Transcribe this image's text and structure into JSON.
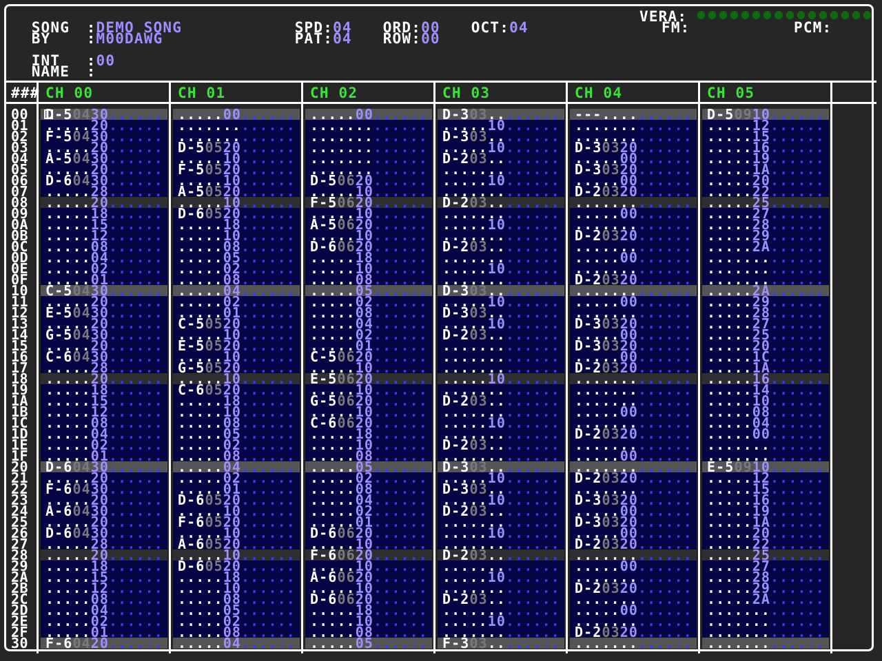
{
  "header": {
    "song_label": "SONG",
    "song_value": "DEMO SONG",
    "by_label": "BY",
    "by_value": "M00DAWG",
    "spd_label": "SPD:",
    "spd_value": "04",
    "pat_label": "PAT:",
    "pat_value": "04",
    "ord_label": "ORD:",
    "ord_value": "00",
    "row_label": "ROW:",
    "row_value": "00",
    "oct_label": "OCT:",
    "oct_value": "04",
    "vera_label": "VERA:",
    "fm_label": "FM:",
    "pcm_label": "PCM:",
    "int_label": "INT",
    "int_value": "00",
    "name_label": "NAME",
    "colon": ":"
  },
  "colors": {
    "background": "#262626",
    "channel_header": "#37e437",
    "value": "#9d8fff",
    "row_band": "#050545",
    "vera_meter": "#0d6a0d"
  },
  "grid": {
    "row_number_header": "###",
    "channels": [
      "CH 00",
      "CH 01",
      "CH 02",
      "CH 03",
      "CH 04",
      "CH 05"
    ],
    "row_numbers": [
      "00",
      "01",
      "02",
      "03",
      "04",
      "05",
      "06",
      "07",
      "08",
      "09",
      "0A",
      "0B",
      "0C",
      "0D",
      "0E",
      "0F",
      "10",
      "11",
      "12",
      "13",
      "14",
      "15",
      "16",
      "17",
      "18",
      "19",
      "1A",
      "1B",
      "1C",
      "1D",
      "1E",
      "1F",
      "20",
      "21",
      "22",
      "23",
      "24",
      "25",
      "26",
      "27",
      "28",
      "29",
      "2A",
      "2B",
      "2C",
      "2D",
      "2E",
      "2F",
      "30"
    ],
    "cells": [
      [
        "D-50430",
        ".....00",
        ".....00",
        "D-303..",
        "---....",
        "D-50910"
      ],
      [
        ".....20",
        ".......",
        ".......",
        ".....10",
        ".......",
        ".....12"
      ],
      [
        "F-50430",
        ".......",
        ".......",
        "D-303..",
        ".......",
        ".....15"
      ],
      [
        ".....20",
        "D-50520",
        ".......",
        ".....10",
        "D-30320",
        ".....16"
      ],
      [
        "A-50430",
        ".....10",
        ".......",
        "D-203..",
        ".....00",
        ".....19"
      ],
      [
        ".....20",
        "F-50520",
        ".......",
        ".......",
        "D-30320",
        ".....1A"
      ],
      [
        "D-60430",
        ".....10",
        "D-50620",
        ".....10",
        ".....00",
        ".....20"
      ],
      [
        ".....28",
        "A-50520",
        ".....10",
        ".......",
        "D-20320",
        ".....22"
      ],
      [
        ".....20",
        ".....10",
        "F-50620",
        "D-203..",
        ".......",
        ".....25"
      ],
      [
        ".....18",
        "D-60520",
        ".....10",
        ".......",
        ".....00",
        ".....27"
      ],
      [
        ".....15",
        ".....18",
        "A-50620",
        ".....10",
        ".......",
        ".....28"
      ],
      [
        ".....12",
        ".....10",
        ".....10",
        ".......",
        "D-20320",
        ".....29"
      ],
      [
        ".....08",
        ".....08",
        "D-60620",
        "D-203..",
        ".......",
        ".....2A"
      ],
      [
        ".....04",
        ".....05",
        ".....18",
        ".......",
        ".....00",
        "......."
      ],
      [
        ".....02",
        ".....02",
        ".....10",
        ".....10",
        ".......",
        "......."
      ],
      [
        ".....01",
        ".....08",
        ".....08",
        ".......",
        "D-20320",
        "......."
      ],
      [
        "C-50430",
        ".....04",
        ".....05",
        "D-303..",
        ".......",
        ".....2A"
      ],
      [
        ".....20",
        ".....02",
        ".....02",
        ".....10",
        ".....00",
        ".....29"
      ],
      [
        "E-50430",
        ".....01",
        ".....08",
        "D-303..",
        ".......",
        ".....28"
      ],
      [
        ".....20",
        "C-50520",
        ".....04",
        ".....10",
        "D-30320",
        ".....27"
      ],
      [
        "G-50430",
        ".....10",
        ".....02",
        "D-203..",
        ".....00",
        ".....25"
      ],
      [
        ".....20",
        "E-50520",
        ".....01",
        ".......",
        "D-30320",
        ".....20"
      ],
      [
        "C-60430",
        ".....10",
        "C-50620",
        ".......",
        ".....00",
        ".....1C"
      ],
      [
        ".....28",
        "G-50520",
        ".....10",
        ".......",
        "D-20320",
        ".....1A"
      ],
      [
        ".....20",
        ".....10",
        "E-50620",
        ".....10",
        ".......",
        ".....16"
      ],
      [
        ".....18",
        "C-60520",
        ".....10",
        ".......",
        ".......",
        ".....14"
      ],
      [
        ".....15",
        ".....18",
        "G-50620",
        "D-203..",
        ".......",
        ".....10"
      ],
      [
        ".....12",
        ".....10",
        ".....10",
        ".......",
        ".....00",
        ".....08"
      ],
      [
        ".....08",
        ".....08",
        "C-60620",
        ".....10",
        ".......",
        ".....04"
      ],
      [
        ".....04",
        ".....05",
        ".....18",
        ".......",
        "D-20320",
        ".....00"
      ],
      [
        ".....02",
        ".....02",
        ".....10",
        "D-203..",
        ".......",
        "......."
      ],
      [
        ".....01",
        ".....08",
        ".....08",
        ".......",
        ".....00",
        "......."
      ],
      [
        "D-60430",
        ".....04",
        ".....05",
        "D-303..",
        ".......",
        "E-50910"
      ],
      [
        ".....20",
        ".....02",
        ".....02",
        ".....10",
        "D-20320",
        ".....12"
      ],
      [
        "F-60430",
        ".....01",
        ".....08",
        "D-303..",
        ".......",
        ".....15"
      ],
      [
        ".....20",
        "D-60520",
        ".....04",
        ".....10",
        "D-30320",
        ".....16"
      ],
      [
        "A-60430",
        ".....10",
        ".....02",
        "D-203..",
        ".....00",
        ".....19"
      ],
      [
        ".....20",
        "F-60520",
        ".....01",
        ".......",
        "D-30320",
        ".....1A"
      ],
      [
        "D-60430",
        ".....10",
        "D-60620",
        ".....10",
        ".....00",
        ".....20"
      ],
      [
        ".....28",
        "A-60520",
        ".....10",
        ".......",
        "D-20320",
        ".....22"
      ],
      [
        ".....20",
        ".....10",
        "F-60620",
        "D-203..",
        ".......",
        ".....25"
      ],
      [
        ".....18",
        "D-60520",
        ".....10",
        ".......",
        ".....00",
        ".....27"
      ],
      [
        ".....15",
        ".....18",
        "A-60620",
        ".....10",
        ".......",
        ".....28"
      ],
      [
        ".....12",
        ".....10",
        ".....10",
        ".......",
        "D-20320",
        ".....29"
      ],
      [
        ".....08",
        ".....08",
        "D-60620",
        "D-203..",
        ".......",
        ".....2A"
      ],
      [
        ".....04",
        ".....05",
        ".....18",
        ".......",
        ".....00",
        "......."
      ],
      [
        ".....02",
        ".....02",
        ".....10",
        ".....10",
        ".......",
        "......."
      ],
      [
        ".....01",
        ".....08",
        ".....08",
        ".......",
        "D-20320",
        "......."
      ],
      [
        "F-60420",
        ".....04",
        ".....05",
        "F-303..",
        ".......",
        "......."
      ]
    ]
  }
}
